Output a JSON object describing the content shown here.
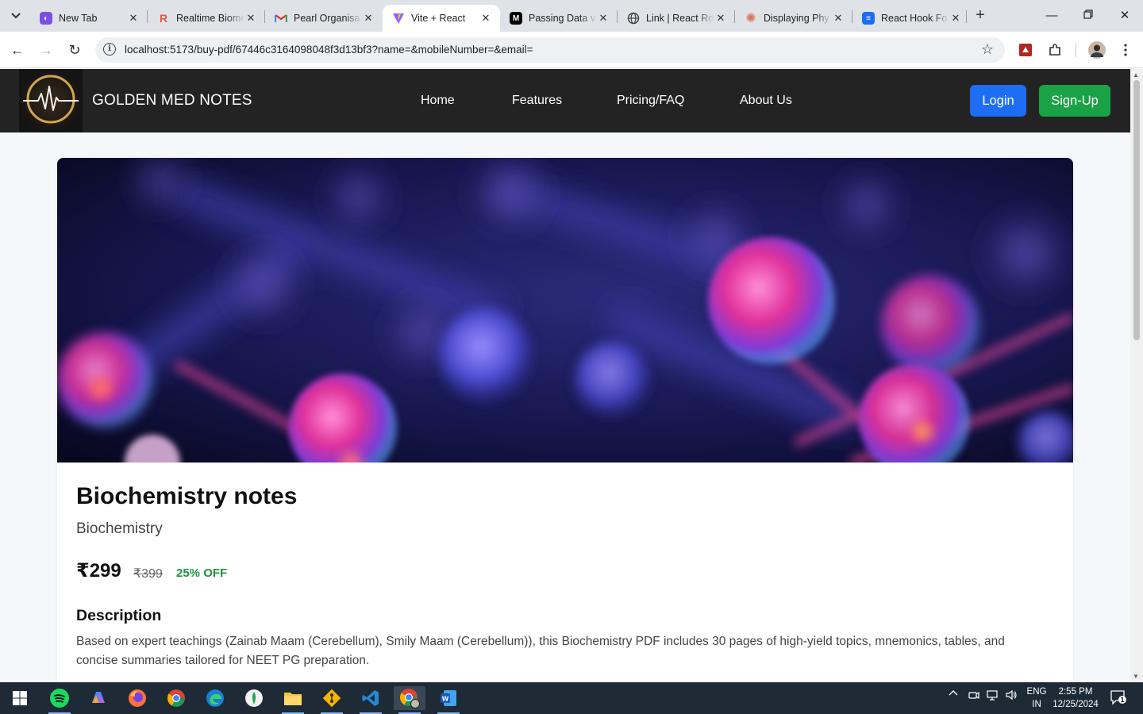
{
  "browser": {
    "tabs": [
      {
        "title": "New Tab",
        "favicon": "copilot-icon",
        "color": "#7b4fe0"
      },
      {
        "title": "Realtime Biome",
        "favicon": "render-icon",
        "color": "#e8553c"
      },
      {
        "title": "Pearl Organisa",
        "favicon": "gmail-icon",
        "color": "#d93025"
      },
      {
        "title": "Vite + React",
        "favicon": "vite-icon",
        "color": "#8a63ff",
        "active": true
      },
      {
        "title": "Passing Data v",
        "favicon": "medium-icon",
        "color": "#000000"
      },
      {
        "title": "Link | React Ro",
        "favicon": "globe-icon",
        "color": "#444444"
      },
      {
        "title": "Displaying Phy",
        "favicon": "claude-icon",
        "color": "#d97757"
      },
      {
        "title": "React Hook Fo",
        "favicon": "react-hook-form-icon",
        "color": "#1d6ef5"
      }
    ],
    "url": "localhost:5173/buy-pdf/67446c3164098048f3d13bf3?name=&mobileNumber=&email="
  },
  "site": {
    "brand": "GOLDEN MED NOTES",
    "nav": [
      "Home",
      "Features",
      "Pricing/FAQ",
      "About Us"
    ],
    "login_label": "Login",
    "signup_label": "Sign-Up",
    "colors": {
      "login": "#1d6ef5",
      "signup": "#1aa346",
      "navbar": "#232323",
      "discount": "#1c9440"
    }
  },
  "product": {
    "title": "Biochemistry notes",
    "subject": "Biochemistry",
    "price": "₹299",
    "original_price": "₹399",
    "discount": "25% OFF",
    "description_heading": "Description",
    "description": "Based on expert teachings (Zainab Maam (Cerebellum), Smily Maam (Cerebellum)), this Biochemistry PDF includes 30 pages of high-yield topics, mnemonics, tables, and concise summaries tailored for NEET PG preparation."
  },
  "taskbar": {
    "apps": [
      "windows-start-icon",
      "spotify-icon",
      "copilot-icon",
      "firefox-icon",
      "chrome-icon",
      "edge-icon",
      "mongodb-compass-icon",
      "file-explorer-icon",
      "git-icon",
      "vscode-icon",
      "chrome-profile-icon",
      "word-icon"
    ],
    "lang_top": "ENG",
    "lang_bottom": "IN",
    "time": "2:55 PM",
    "date": "12/25/2024",
    "notifications": "1"
  }
}
